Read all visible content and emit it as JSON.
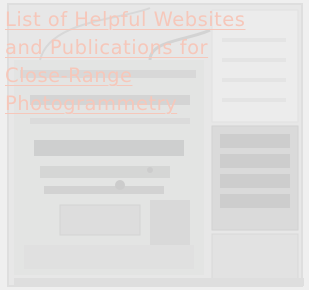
{
  "link": {
    "title_lines": [
      "List of Helpful Websites",
      "and Publications for",
      "Close-Range",
      "Photogrammetry"
    ]
  },
  "colors": {
    "link_text": "#f6c7ba",
    "background": "#f3f3f3"
  },
  "background_image": {
    "subject": "computer tower interior with motherboard and drive bays",
    "faded": true
  }
}
